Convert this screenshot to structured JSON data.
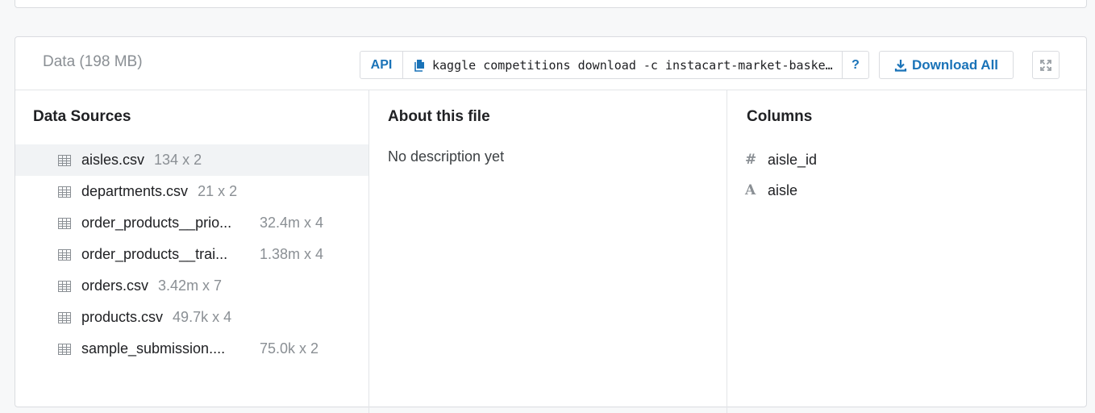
{
  "header": {
    "title": "Data (198 MB)",
    "api_label": "API",
    "command": "kaggle competitions download -c instacart-market-basket-analysis",
    "help_label": "?",
    "download_label": "Download All",
    "icons": {
      "copy": "copy-icon",
      "download": "download-icon",
      "expand": "expand-icon"
    }
  },
  "sources": {
    "heading": "Data Sources",
    "files": [
      {
        "name": "aisles.csv",
        "dims": "134 x 2",
        "selected": true
      },
      {
        "name": "departments.csv",
        "dims": "21 x 2",
        "selected": false
      },
      {
        "name": "order_products__prio...",
        "dims": "32.4m x 4",
        "selected": false
      },
      {
        "name": "order_products__trai...",
        "dims": "1.38m x 4",
        "selected": false
      },
      {
        "name": "orders.csv",
        "dims": "3.42m x 7",
        "selected": false
      },
      {
        "name": "products.csv",
        "dims": "49.7k x 4",
        "selected": false
      },
      {
        "name": "sample_submission....",
        "dims": "75.0k x 2",
        "selected": false
      }
    ]
  },
  "about": {
    "heading": "About this file",
    "description": "No description yet"
  },
  "columns": {
    "heading": "Columns",
    "items": [
      {
        "type_glyph": "#",
        "name": "aisle_id"
      },
      {
        "type_glyph": "A",
        "name": "aisle"
      }
    ]
  },
  "colors": {
    "accent": "#1a73b8",
    "muted": "#8a8f94",
    "selected_row": "#f1f3f5"
  }
}
